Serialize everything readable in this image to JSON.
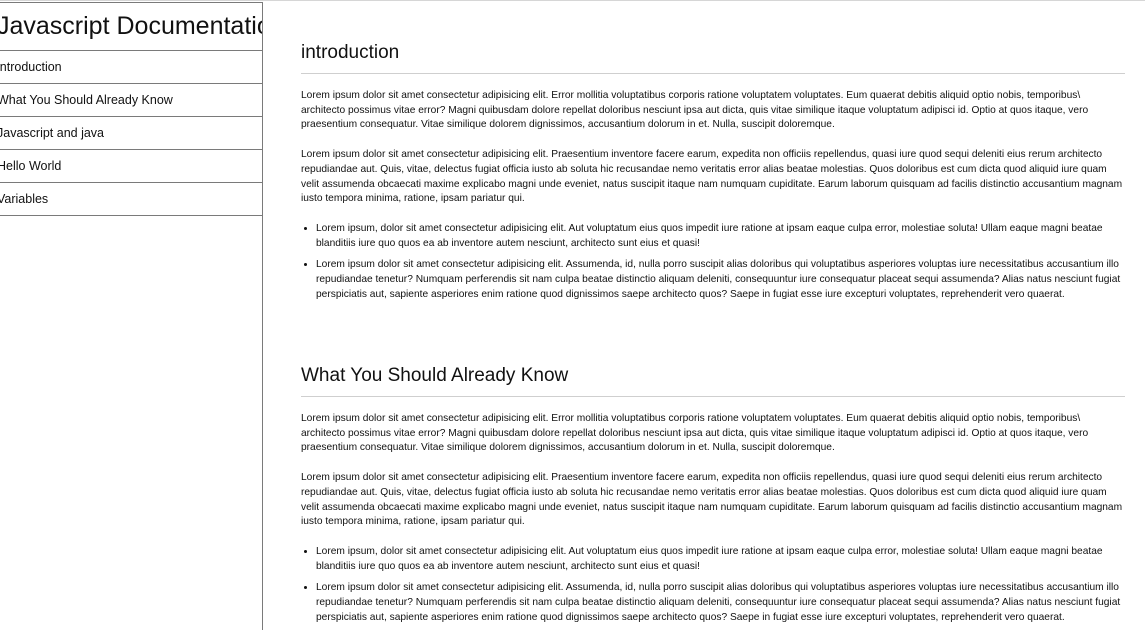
{
  "navbar": {
    "title": "Javascript Documentation",
    "items": [
      {
        "label": "introduction"
      },
      {
        "label": "What You Should Already Know"
      },
      {
        "label": "Javascript and java"
      },
      {
        "label": "Hello World"
      },
      {
        "label": "Variables"
      }
    ]
  },
  "sections": [
    {
      "title": "introduction",
      "paragraphs": [
        "Lorem ipsum dolor sit amet consectetur adipisicing elit. Error mollitia voluptatibus corporis ratione voluptatem voluptates. Eum quaerat debitis aliquid optio nobis, temporibus\\ architecto possimus vitae error? Magni quibusdam dolore repellat doloribus nesciunt ipsa aut dicta, quis vitae similique itaque voluptatum adipisci id. Optio at quos itaque, vero praesentium consequatur. Vitae similique dolorem dignissimos, accusantium dolorum in et. Nulla, suscipit doloremque.",
        "Lorem ipsum dolor sit amet consectetur adipisicing elit. Praesentium inventore facere earum, expedita non officiis repellendus, quasi iure quod sequi deleniti eius rerum architecto repudiandae aut. Quis, vitae, delectus fugiat officia iusto ab soluta hic recusandae nemo veritatis error alias beatae molestias. Quos doloribus est cum dicta quod aliquid iure quam velit assumenda obcaecati maxime explicabo magni unde eveniet, natus suscipit itaque nam numquam cupiditate. Earum laborum quisquam ad facilis distinctio accusantium magnam iusto tempora minima, ratione, ipsam pariatur qui."
      ],
      "list": [
        "Lorem ipsum, dolor sit amet consectetur adipisicing elit. Aut voluptatum eius quos impedit iure ratione at ipsam eaque culpa error, molestiae soluta! Ullam eaque magni beatae blanditiis iure quo quos ea ab inventore autem nesciunt, architecto sunt eius et quasi!",
        "Lorem ipsum dolor sit amet consectetur adipisicing elit. Assumenda, id, nulla porro suscipit alias doloribus qui voluptatibus asperiores voluptas iure necessitatibus accusantium illo repudiandae tenetur? Numquam perferendis sit nam culpa beatae distinctio aliquam deleniti, consequuntur iure consequatur placeat sequi assumenda? Alias natus nesciunt fugiat perspiciatis aut, sapiente asperiores enim ratione quod dignissimos saepe architecto quos? Saepe in fugiat esse iure excepturi voluptates, reprehenderit vero quaerat."
      ]
    },
    {
      "title": "What You Should Already Know",
      "paragraphs": [
        "Lorem ipsum dolor sit amet consectetur adipisicing elit. Error mollitia voluptatibus corporis ratione voluptatem voluptates. Eum quaerat debitis aliquid optio nobis, temporibus\\ architecto possimus vitae error? Magni quibusdam dolore repellat doloribus nesciunt ipsa aut dicta, quis vitae similique itaque voluptatum adipisci id. Optio at quos itaque, vero praesentium consequatur. Vitae similique dolorem dignissimos, accusantium dolorum in et. Nulla, suscipit doloremque.",
        "Lorem ipsum dolor sit amet consectetur adipisicing elit. Praesentium inventore facere earum, expedita non officiis repellendus, quasi iure quod sequi deleniti eius rerum architecto repudiandae aut. Quis, vitae, delectus fugiat officia iusto ab soluta hic recusandae nemo veritatis error alias beatae molestias. Quos doloribus est cum dicta quod aliquid iure quam velit assumenda obcaecati maxime explicabo magni unde eveniet, natus suscipit itaque nam numquam cupiditate. Earum laborum quisquam ad facilis distinctio accusantium magnam iusto tempora minima, ratione, ipsam pariatur qui."
      ],
      "list": [
        "Lorem ipsum, dolor sit amet consectetur adipisicing elit. Aut voluptatum eius quos impedit iure ratione at ipsam eaque culpa error, molestiae soluta! Ullam eaque magni beatae blanditiis iure quo quos ea ab inventore autem nesciunt, architecto sunt eius et quasi!",
        "Lorem ipsum dolor sit amet consectetur adipisicing elit. Assumenda, id, nulla porro suscipit alias doloribus qui voluptatibus asperiores voluptas iure necessitatibus accusantium illo repudiandae tenetur? Numquam perferendis sit nam culpa beatae distinctio aliquam deleniti, consequuntur iure consequatur placeat sequi assumenda? Alias natus nesciunt fugiat perspiciatis aut, sapiente asperiores enim ratione quod dignissimos saepe architecto quos? Saepe in fugiat esse iure excepturi voluptates, reprehenderit vero quaerat."
      ]
    }
  ]
}
